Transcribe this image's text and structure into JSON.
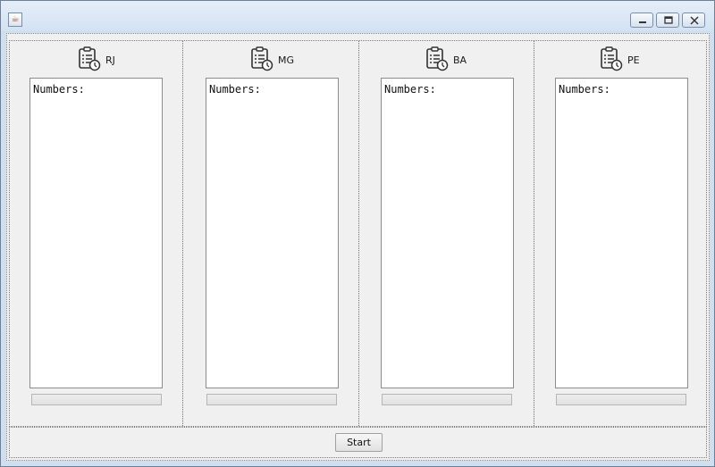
{
  "window": {
    "app_icon": "java-app-icon",
    "controls": [
      "minimize-icon",
      "maximize-icon",
      "close-icon"
    ]
  },
  "panels": [
    {
      "label": "RJ",
      "icon": "clipboard-clock-icon",
      "text": "Numbers:",
      "progress": 0
    },
    {
      "label": "MG",
      "icon": "clipboard-clock-icon",
      "text": "Numbers:",
      "progress": 0
    },
    {
      "label": "BA",
      "icon": "clipboard-clock-icon",
      "text": "Numbers:",
      "progress": 0
    },
    {
      "label": "PE",
      "icon": "clipboard-clock-icon",
      "text": "Numbers:",
      "progress": 0
    }
  ],
  "footer": {
    "start_label": "Start"
  },
  "colors": {
    "titlebar": "#d3e2f2",
    "client_bg": "#f0f0f0",
    "progress_fill": "#4caf50"
  }
}
